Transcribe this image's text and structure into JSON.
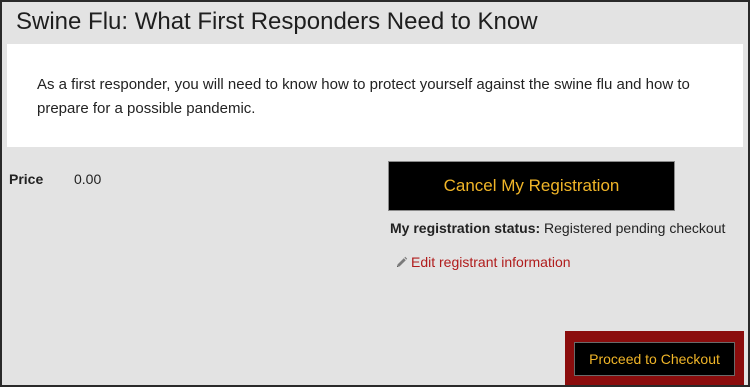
{
  "event": {
    "title": "Swine Flu: What First Responders Need to Know",
    "description": "As a first responder, you will need to know how to protect yourself against the swine flu and how to prepare for a possible pandemic."
  },
  "price": {
    "label": "Price",
    "value": "0.00"
  },
  "actions": {
    "cancel_label": "Cancel My Registration",
    "edit_label": "Edit registrant information",
    "checkout_label": "Proceed to Checkout"
  },
  "status": {
    "label": "My registration status:",
    "value": "Registered pending checkout"
  },
  "icons": {
    "edit": "pencil-icon"
  },
  "colors": {
    "accent_text": "#f0b528",
    "button_bg": "#000000",
    "link": "#b01c1c",
    "checkout_border": "#8b0d0d",
    "panel_bg": "#e3e3e3"
  }
}
